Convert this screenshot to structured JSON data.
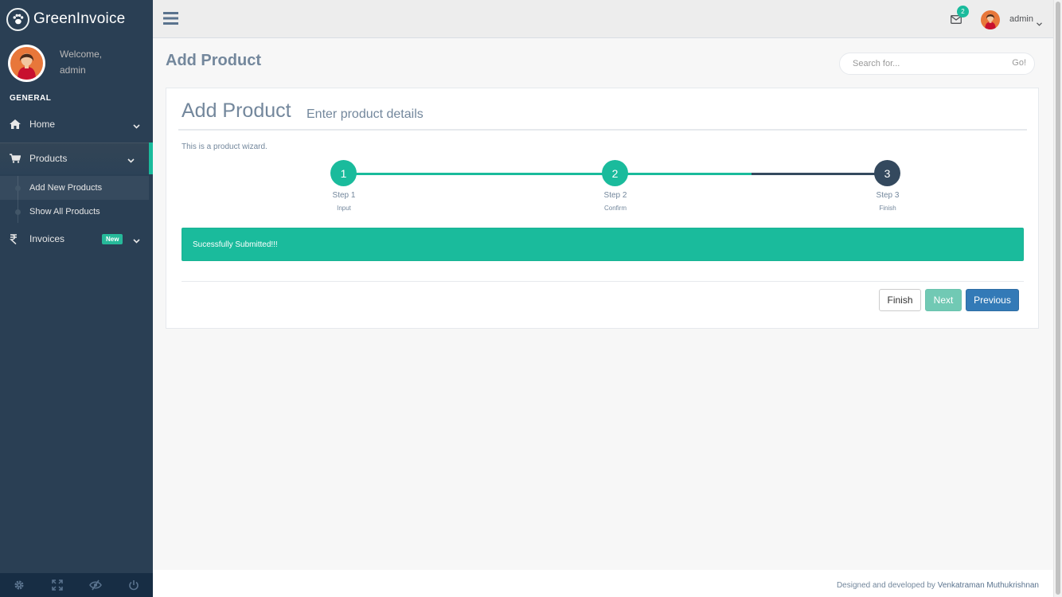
{
  "brand": {
    "name": "GreenInvoice"
  },
  "profile": {
    "welcome": "Welcome,",
    "name": "admin"
  },
  "sidebar": {
    "section": "GENERAL",
    "items": [
      {
        "label": "Home",
        "icon": "home-icon"
      },
      {
        "label": "Products",
        "icon": "cart-icon",
        "children": [
          "Add New Products",
          "Show All Products"
        ]
      },
      {
        "label": "Invoices",
        "icon": "rupee-icon",
        "badge": "New"
      }
    ],
    "footer_icons": [
      "gear-icon",
      "fullscreen-icon",
      "eye-slash-icon",
      "power-icon"
    ]
  },
  "topnav": {
    "mail_count": "2",
    "user": "admin"
  },
  "page": {
    "title": "Add Product",
    "search": {
      "placeholder": "Search for...",
      "button": "Go!"
    }
  },
  "panel": {
    "title": "Add Product",
    "subtitle": "Enter product details",
    "description": "This is a product wizard.",
    "steps": [
      {
        "number": "1",
        "label": "Step 1",
        "desc": "Input"
      },
      {
        "number": "2",
        "label": "Step 2",
        "desc": "Confirm"
      },
      {
        "number": "3",
        "label": "Step 3",
        "desc": "Finish"
      }
    ],
    "alert": "Sucessfully Submitted!!!",
    "buttons": {
      "finish": "Finish",
      "next": "Next",
      "previous": "Previous"
    }
  },
  "footer": {
    "text": "Designed and developed by",
    "author": "Venkatraman Muthukrishnan"
  },
  "colors": {
    "sidebar": "#2A3F54",
    "accent": "#1ABB9C",
    "primary": "#337AB7",
    "step_current": "#34495E"
  }
}
